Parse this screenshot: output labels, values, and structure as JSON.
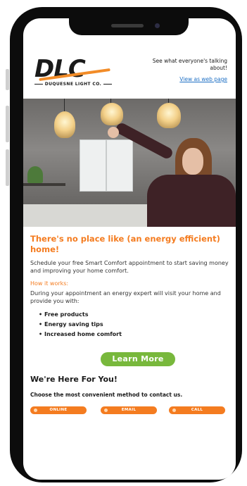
{
  "header": {
    "logo_text": "DLC",
    "logo_sub": "DUQUESNE LIGHT CO.",
    "tagline": "See what everyone's talking about!",
    "view_link": "View as web page"
  },
  "main": {
    "headline": "There's no place like (an energy efficient) home!",
    "intro": "Schedule your free Smart Comfort appointment to start saving money and improving your home comfort.",
    "how_label": "How it works:",
    "during_text": "During your appointment an energy expert will visit your home and provide you with:",
    "bullets": [
      "Free products",
      "Energy saving tips",
      "Increased home comfort"
    ],
    "learn_more": "Learn More"
  },
  "contact": {
    "heading": "We're Here For You!",
    "subheading": "Choose the most convenient method to contact us.",
    "buttons": [
      "ONLINE",
      "EMAIL",
      "CALL"
    ]
  },
  "colors": {
    "accent": "#f47c20",
    "button_green": "#78b83c",
    "link_blue": "#1d6fc4"
  }
}
